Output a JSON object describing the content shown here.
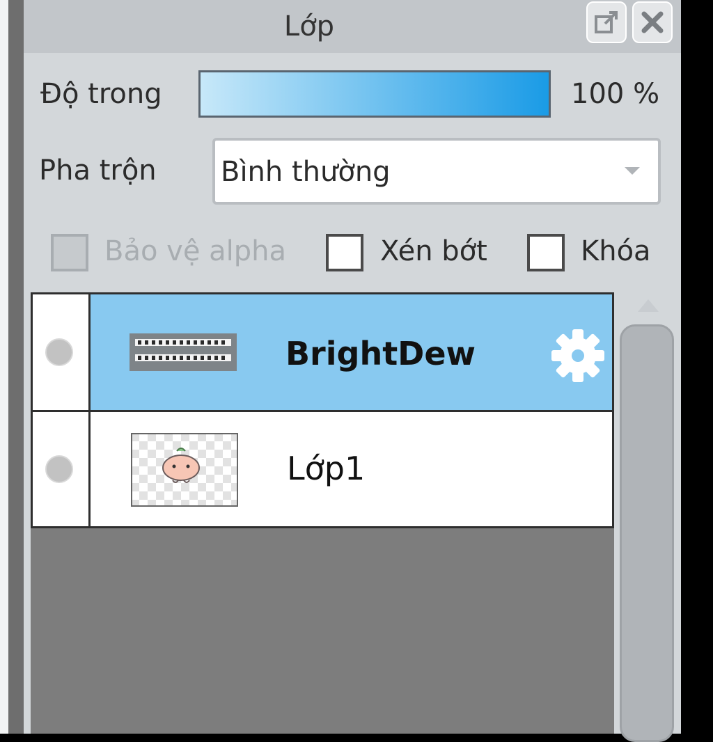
{
  "window": {
    "title": "Lớp",
    "popout_icon": "popout-icon",
    "close_icon": "close-icon"
  },
  "opacity": {
    "label": "Độ trong",
    "value_text": "100 %",
    "value": 1.0,
    "fill_start": "#c7e8f9",
    "fill_end": "#1a9be6"
  },
  "blend": {
    "label": "Pha trộn",
    "selected": "Bình thường"
  },
  "options": {
    "alpha_protect": {
      "label": "Bảo vệ alpha",
      "checked": false,
      "disabled": true
    },
    "clipping": {
      "label": "Xén bớt",
      "checked": false
    },
    "lock": {
      "label": "Khóa",
      "checked": false
    }
  },
  "layers": [
    {
      "name": "BrightDew",
      "selected": true,
      "highlight": "#88c9f0",
      "thumb": "text-thumbnail",
      "settings_icon": "gear-icon"
    },
    {
      "name": "Lớp1",
      "selected": false,
      "thumb": "character-thumbnail"
    }
  ]
}
